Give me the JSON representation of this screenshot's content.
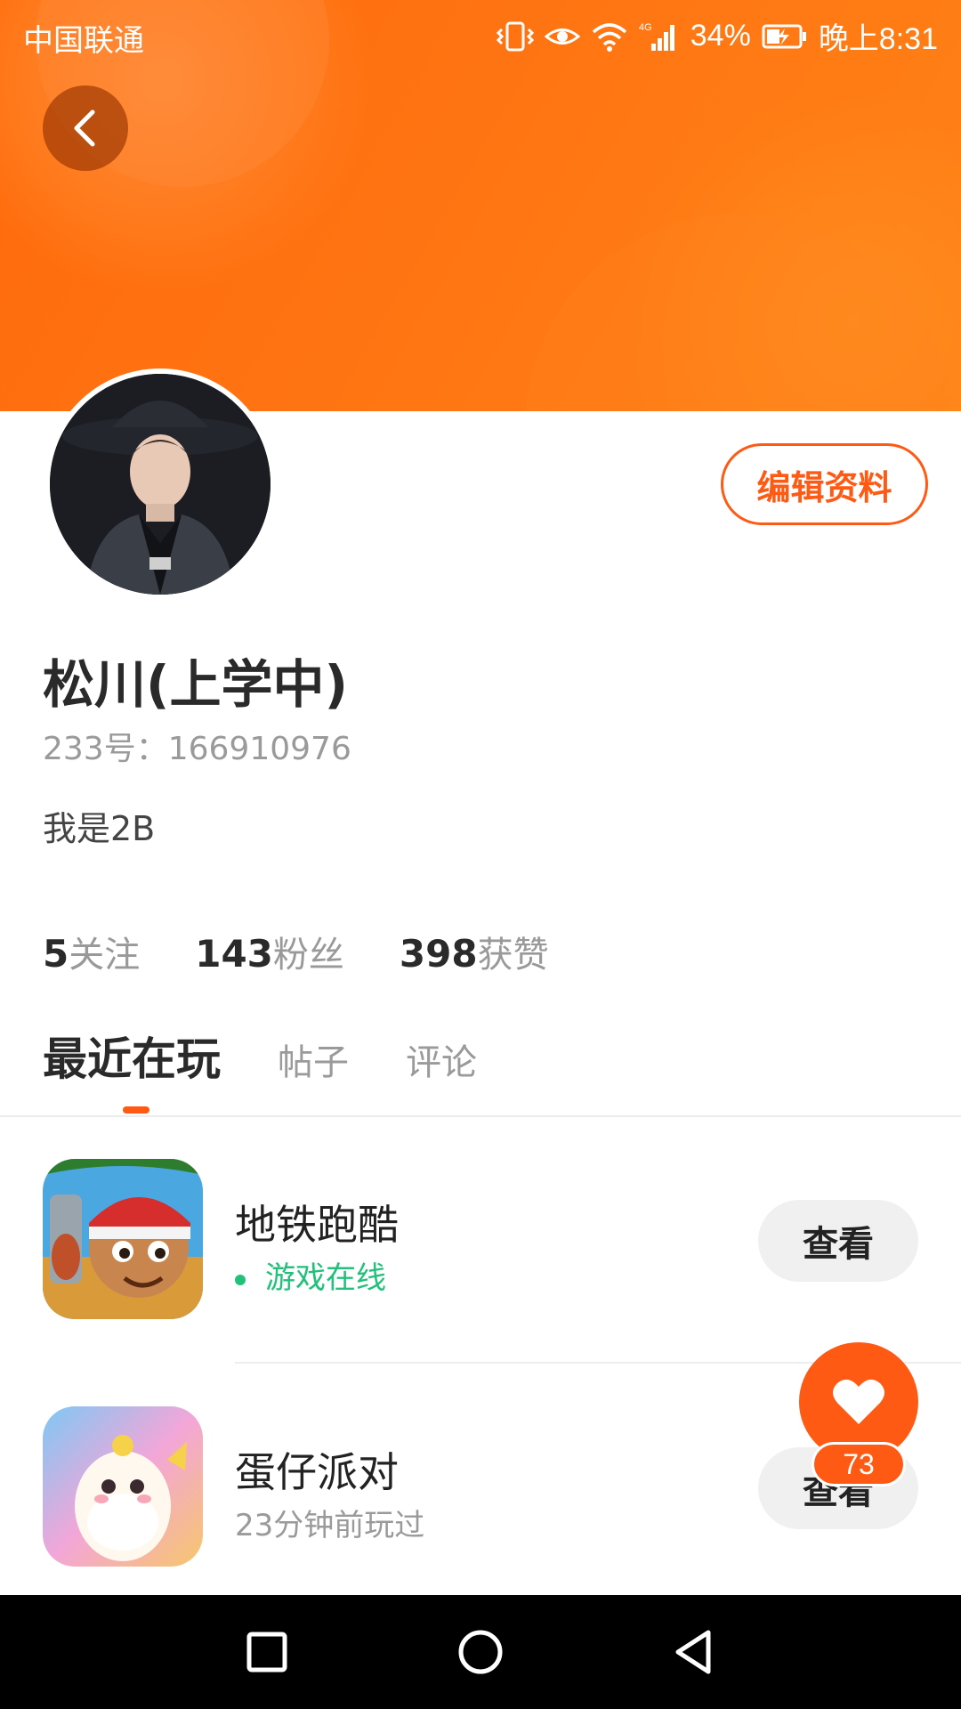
{
  "status_bar": {
    "carrier": "中国联通",
    "battery": "34%",
    "time": "晚上8:31",
    "network": "4G"
  },
  "profile": {
    "name": "松川(上学中)",
    "id_text": "233号：166910976",
    "bio": "我是2B",
    "edit_label": "编辑资料"
  },
  "stats": [
    {
      "value": "5",
      "label": "关注"
    },
    {
      "value": "143",
      "label": "粉丝"
    },
    {
      "value": "398",
      "label": "获赞"
    }
  ],
  "tabs": [
    {
      "label": "最近在玩",
      "active": true
    },
    {
      "label": "帖子",
      "active": false
    },
    {
      "label": "评论",
      "active": false
    }
  ],
  "games": [
    {
      "title": "地铁跑酷",
      "status": "游戏在线",
      "online": true,
      "button": "查看"
    },
    {
      "title": "蛋仔派对",
      "status": "23分钟前玩过",
      "online": false,
      "button": "查看"
    }
  ],
  "fab": {
    "badge": "73",
    "icon": "heart-icon"
  },
  "colors": {
    "accent": "#ff5a14",
    "banner": "#ff7412",
    "online": "#22c07a"
  }
}
